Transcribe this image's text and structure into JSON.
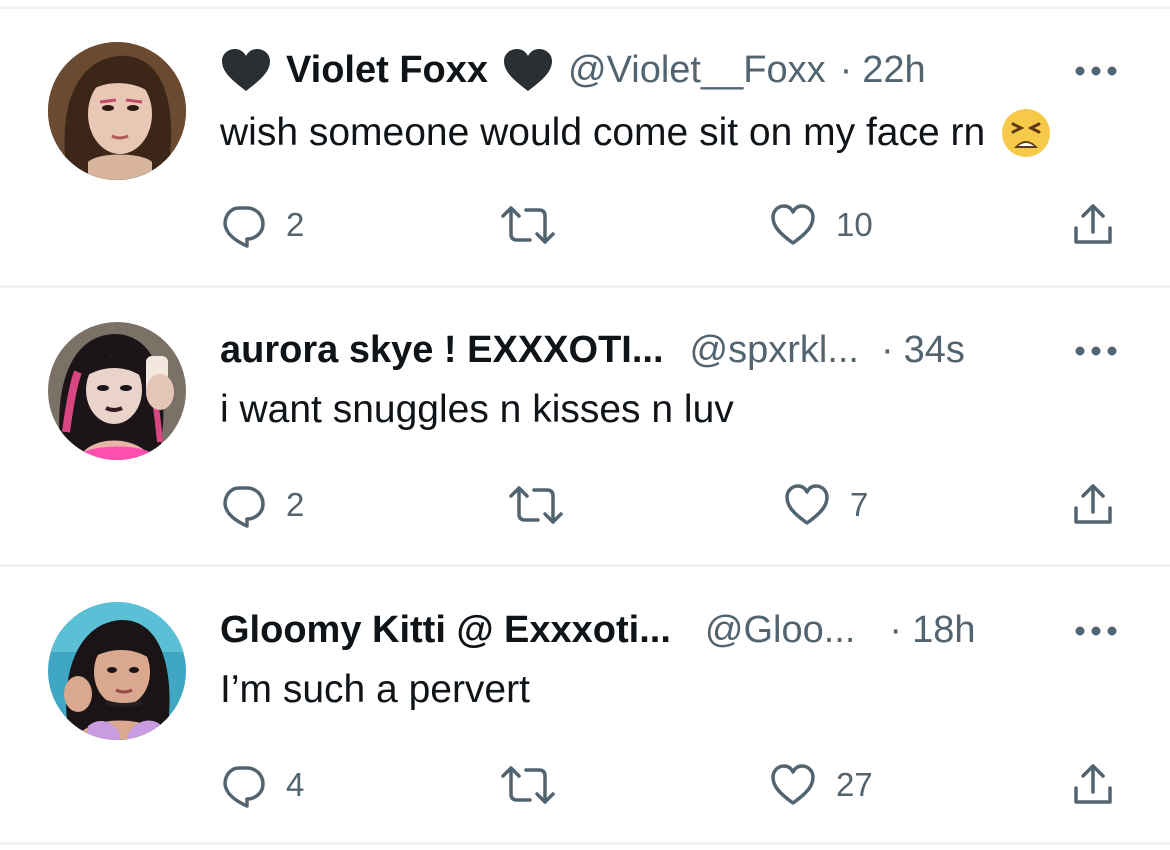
{
  "tweets": [
    {
      "name": "Violet Foxx",
      "handle": "@Violet__Foxx",
      "separator": "·",
      "time": "22h",
      "text": "wish someone would come sit on my face rn",
      "emoji": "tired-face-emoji",
      "replies": "2",
      "retweets": "",
      "likes": "10",
      "name_decorations": [
        "black-heart-icon",
        "black-heart-icon"
      ]
    },
    {
      "name": "aurora skye ! EXXXOTI...",
      "handle": "@spxrkl...",
      "separator": "·",
      "time": "34s",
      "text": "i want snuggles n kisses n luv",
      "replies": "2",
      "retweets": "",
      "likes": "7"
    },
    {
      "name": "Gloomy Kitti @ Exxxoti...",
      "handle": "@Gloo...",
      "separator": "·",
      "time": "18h",
      "text": "I’m such a pervert",
      "replies": "4",
      "retweets": "",
      "likes": "27"
    }
  ],
  "colors": {
    "text_primary": "#0f1419",
    "text_secondary": "#536471",
    "divider": "#eff3f4",
    "icon": "#536471"
  },
  "icons": {
    "reply": "reply-icon",
    "retweet": "retweet-icon",
    "like": "like-heart-icon",
    "share": "share-icon",
    "more": "more-dots-icon"
  }
}
